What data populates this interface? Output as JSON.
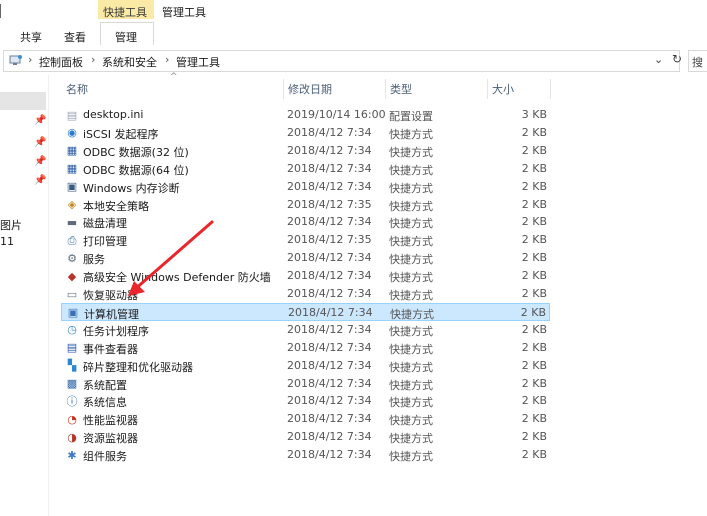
{
  "ribbon": {
    "context_group": "快捷工具",
    "context_title": "管理工具",
    "tabs": {
      "share": "共享",
      "view": "查看",
      "manage": "管理"
    }
  },
  "address": {
    "crumbs": [
      "控制面板",
      "系统和安全",
      "管理工具"
    ],
    "search_placeholder_char": "搜"
  },
  "nav": {
    "items": [
      {
        "label": "图片"
      },
      {
        "label": "11"
      }
    ]
  },
  "columns": {
    "name": "名称",
    "date": "修改日期",
    "type": "类型",
    "size": "大小"
  },
  "files": [
    {
      "name": "desktop.ini",
      "date": "2019/10/14 16:00",
      "type": "配置设置",
      "size": "3 KB",
      "icon": "ini-file-icon"
    },
    {
      "name": "iSCSI 发起程序",
      "date": "2018/4/12 7:34",
      "type": "快捷方式",
      "size": "2 KB",
      "icon": "iscsi-icon"
    },
    {
      "name": "ODBC 数据源(32 位)",
      "date": "2018/4/12 7:34",
      "type": "快捷方式",
      "size": "2 KB",
      "icon": "odbc-icon"
    },
    {
      "name": "ODBC 数据源(64 位)",
      "date": "2018/4/12 7:34",
      "type": "快捷方式",
      "size": "2 KB",
      "icon": "odbc-icon"
    },
    {
      "name": "Windows 内存诊断",
      "date": "2018/4/12 7:34",
      "type": "快捷方式",
      "size": "2 KB",
      "icon": "memory-diag-icon"
    },
    {
      "name": "本地安全策略",
      "date": "2018/4/12 7:35",
      "type": "快捷方式",
      "size": "2 KB",
      "icon": "security-policy-icon"
    },
    {
      "name": "磁盘清理",
      "date": "2018/4/12 7:34",
      "type": "快捷方式",
      "size": "2 KB",
      "icon": "disk-cleanup-icon"
    },
    {
      "name": "打印管理",
      "date": "2018/4/12 7:35",
      "type": "快捷方式",
      "size": "2 KB",
      "icon": "printer-icon"
    },
    {
      "name": "服务",
      "date": "2018/4/12 7:34",
      "type": "快捷方式",
      "size": "2 KB",
      "icon": "services-icon"
    },
    {
      "name": "高级安全 Windows Defender 防火墙",
      "date": "2018/4/12 7:34",
      "type": "快捷方式",
      "size": "2 KB",
      "icon": "firewall-icon"
    },
    {
      "name": "恢复驱动器",
      "date": "2018/4/12 7:34",
      "type": "快捷方式",
      "size": "2 KB",
      "icon": "recovery-drive-icon"
    },
    {
      "name": "计算机管理",
      "date": "2018/4/12 7:34",
      "type": "快捷方式",
      "size": "2 KB",
      "icon": "computer-mgmt-icon"
    },
    {
      "name": "任务计划程序",
      "date": "2018/4/12 7:34",
      "type": "快捷方式",
      "size": "2 KB",
      "icon": "task-scheduler-icon"
    },
    {
      "name": "事件查看器",
      "date": "2018/4/12 7:34",
      "type": "快捷方式",
      "size": "2 KB",
      "icon": "event-viewer-icon"
    },
    {
      "name": "碎片整理和优化驱动器",
      "date": "2018/4/12 7:34",
      "type": "快捷方式",
      "size": "2 KB",
      "icon": "defrag-icon"
    },
    {
      "name": "系统配置",
      "date": "2018/4/12 7:34",
      "type": "快捷方式",
      "size": "2 KB",
      "icon": "msconfig-icon"
    },
    {
      "name": "系统信息",
      "date": "2018/4/12 7:34",
      "type": "快捷方式",
      "size": "2 KB",
      "icon": "system-info-icon"
    },
    {
      "name": "性能监视器",
      "date": "2018/4/12 7:34",
      "type": "快捷方式",
      "size": "2 KB",
      "icon": "perf-monitor-icon"
    },
    {
      "name": "资源监视器",
      "date": "2018/4/12 7:34",
      "type": "快捷方式",
      "size": "2 KB",
      "icon": "resource-monitor-icon"
    },
    {
      "name": "组件服务",
      "date": "2018/4/12 7:34",
      "type": "快捷方式",
      "size": "2 KB",
      "icon": "component-services-icon"
    }
  ],
  "selected_file": "计算机管理",
  "colors": {
    "selection_bg": "#cce8ff",
    "selection_border": "#99d1ff",
    "context_tab": "#fbe9a6",
    "arrow": "#e8262b",
    "header_text": "#4c607a"
  }
}
